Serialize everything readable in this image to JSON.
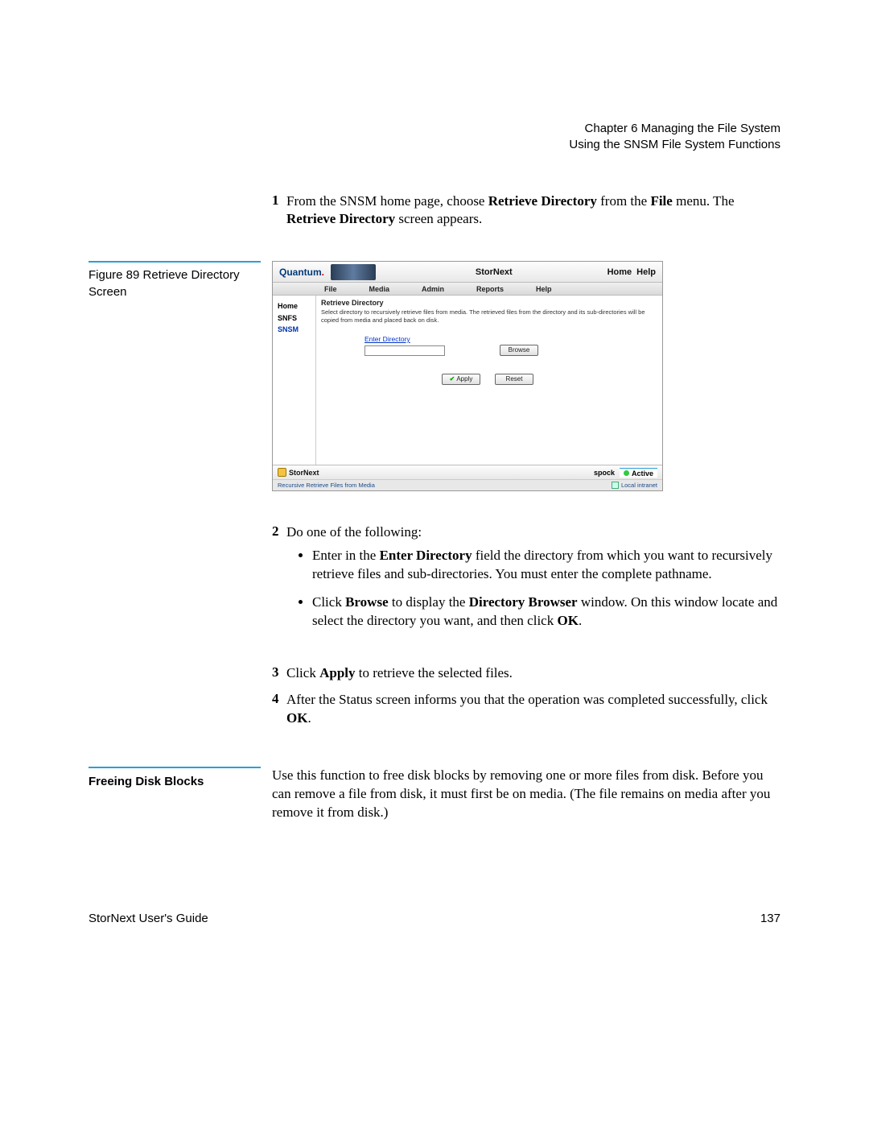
{
  "chapter": {
    "line1": "Chapter 6  Managing the File System",
    "line2": "Using the SNSM File System Functions"
  },
  "step1": {
    "num": "1",
    "pre": "From the SNSM home page, choose ",
    "bold1": "Retrieve Directory",
    "mid1": " from the ",
    "bold2": "File",
    "mid2": " menu. The ",
    "bold3": "Retrieve Directory",
    "post": " screen appears."
  },
  "figure_caption": "Figure 89  Retrieve Directory Screen",
  "ss": {
    "logo": "Quantum",
    "product": "StorNext",
    "home_link": "Home",
    "help_link": "Help",
    "menu": {
      "file": "File",
      "media": "Media",
      "admin": "Admin",
      "reports": "Reports",
      "help": "Help"
    },
    "sidebar": {
      "home": "Home",
      "snfs": "SNFS",
      "snsm": "SNSM"
    },
    "panel_title": "Retrieve Directory",
    "panel_desc": "Select directory to recursively retrieve files from media. The retrieved files from the directory and its sub-directories will be copied from media and placed back on disk.",
    "field_label": "Enter Directory",
    "browse": "Browse",
    "apply": "Apply",
    "reset": "Reset",
    "footer_product": "StorNext",
    "host": "spock",
    "status": "Active",
    "status_text": "Recursive Retrieve Files from Media",
    "zone": "Local intranet"
  },
  "step2": {
    "num": "2",
    "text": "Do one of the following:",
    "bullet1_pre": "Enter in the ",
    "bullet1_b": "Enter Directory",
    "bullet1_post": " field the directory from which you want to recursively retrieve files and sub-directories. You must enter the complete pathname.",
    "bullet2_pre": "Click ",
    "bullet2_b1": "Browse",
    "bullet2_mid": " to display the ",
    "bullet2_b2": "Directory Browser",
    "bullet2_mid2": " window. On this window locate and select the directory you want, and then click ",
    "bullet2_b3": "OK",
    "bullet2_post": "."
  },
  "step3": {
    "num": "3",
    "pre": "Click ",
    "b": "Apply",
    "post": " to retrieve the selected files."
  },
  "step4": {
    "num": "4",
    "pre": "After the Status screen informs you that the operation was completed successfully, click ",
    "b": "OK",
    "post": "."
  },
  "section_heading": "Freeing Disk Blocks",
  "section_para": "Use this function to free disk blocks by removing one or more files from disk. Before you can remove a file from disk, it must first be on media. (The file remains on media after you remove it from disk.)",
  "footer": {
    "left": "StorNext User's Guide",
    "right": "137"
  }
}
